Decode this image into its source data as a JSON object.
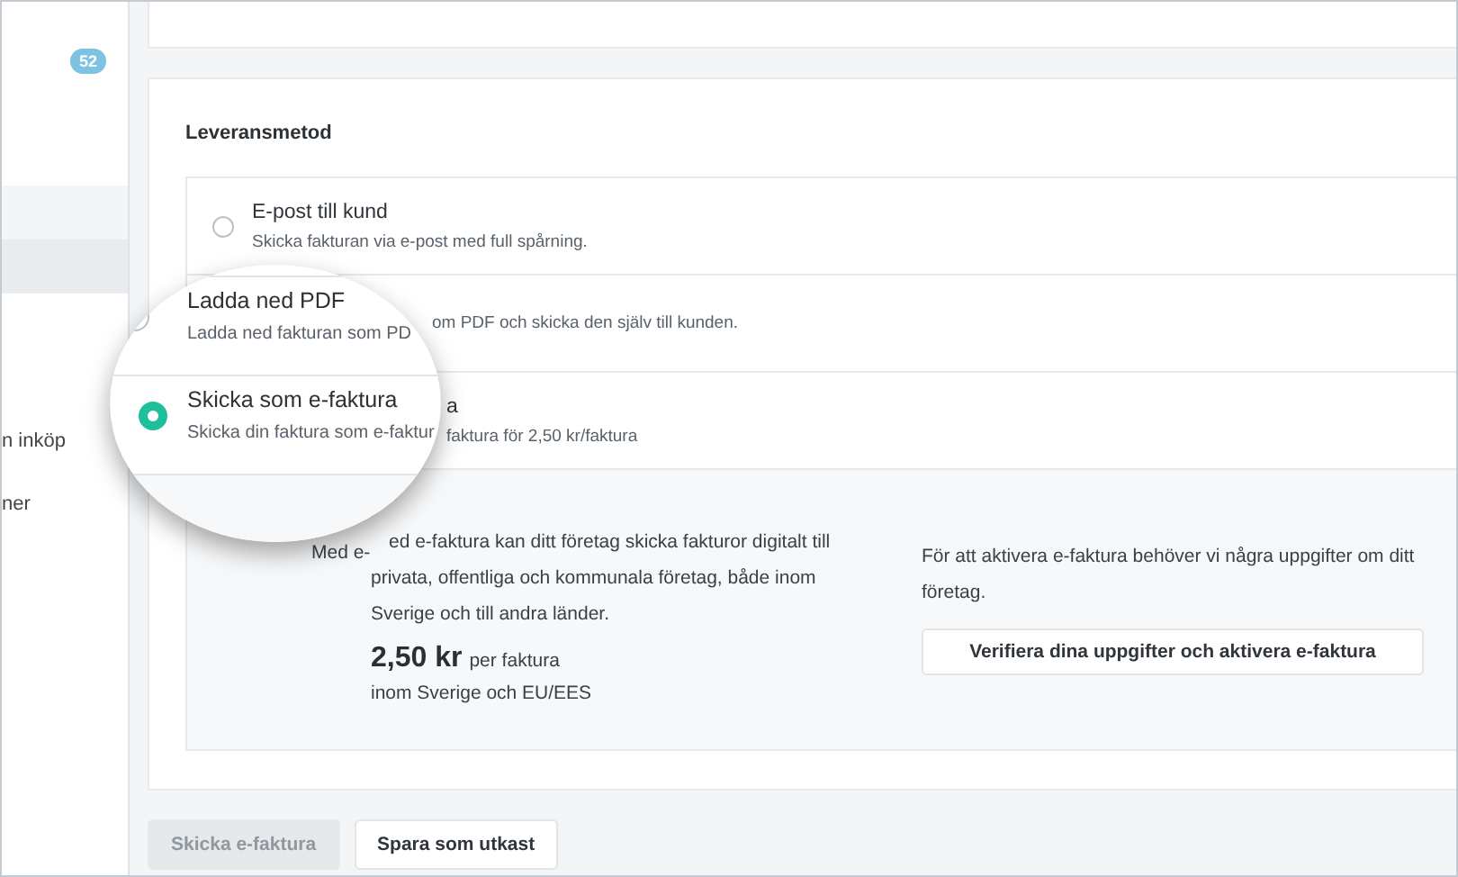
{
  "sidebar": {
    "badge": "52",
    "items": [
      {
        "label": "n inköp"
      },
      {
        "label": "ner"
      }
    ]
  },
  "delivery": {
    "heading": "Leveransmetod",
    "options": [
      {
        "title": "E-post till kund",
        "description": "Skicka fakturan via e-post med full spårning.",
        "selected": false
      },
      {
        "description": "om PDF och skicka den själv till kunden."
      },
      {
        "title": "a",
        "description": "faktura för 2,50 kr/faktura"
      }
    ],
    "info": {
      "lines": [
        "ed e-faktura kan ditt företag skicka fakturor digitalt till",
        "privata, offentliga och kommunala företag, både inom",
        "Sverige och till andra länder."
      ],
      "price": "2,50 kr",
      "price_unit": "per faktura",
      "price_note": "inom Sverige och EU/EES",
      "activation_text": "För att aktivera e-faktura behöver vi några uppgifter om ditt företag.",
      "activation_button": "Verifiera dina uppgifter och aktivera e-faktura"
    }
  },
  "magnifier": {
    "options": [
      {
        "title": "Ladda ned PDF",
        "description": "Ladda ned fakturan som PD",
        "selected": false
      },
      {
        "title": "Skicka som e-faktura",
        "description": "Skicka din faktura som e-faktur",
        "selected": true
      }
    ],
    "caption": "Med e-"
  },
  "buttons": [
    {
      "label": "Skicka e-faktura",
      "disabled": true
    },
    {
      "label": "Spara som utkast",
      "disabled": false
    }
  ]
}
